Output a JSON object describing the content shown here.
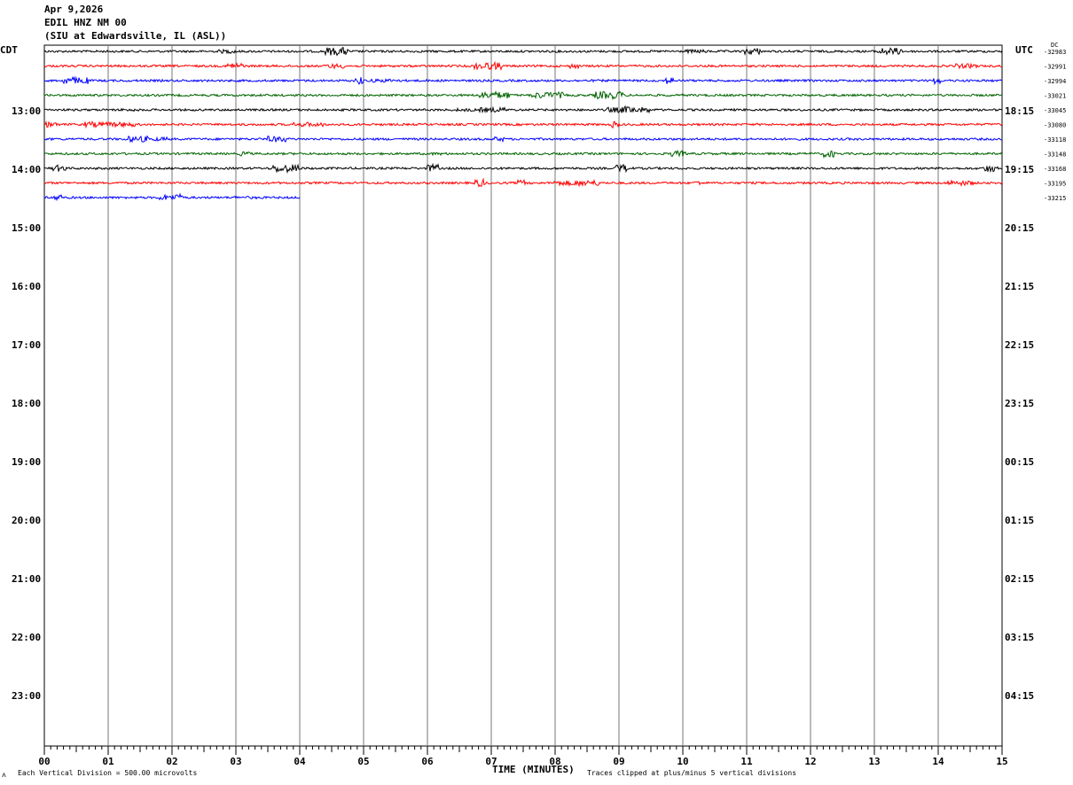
{
  "header": {
    "date": "Apr 9,2026",
    "channel": "EDIL HNZ NM 00",
    "station": "(SIU at Edwardsville, IL  (ASL))"
  },
  "footer": {
    "scale_note": "Each Vertical Division =  500.00 microvolts",
    "clip_note": "Traces clipped at plus/minus 5 vertical divisions",
    "corner_mark": "ᴧ"
  },
  "chart_data": {
    "type": "line",
    "title": "EDIL HNZ NM 00",
    "xlabel": "TIME (MINUTES)",
    "xlim": [
      0,
      15
    ],
    "x_ticks": [
      "00",
      "01",
      "02",
      "03",
      "04",
      "05",
      "06",
      "07",
      "08",
      "09",
      "10",
      "11",
      "12",
      "13",
      "14",
      "15"
    ],
    "left_axis_label": "CDT",
    "right_axis_label": "UTC",
    "dc_label": "DC",
    "left_time_labels": [
      "13:00",
      "14:00",
      "15:00",
      "16:00",
      "17:00",
      "18:00",
      "19:00",
      "20:00",
      "21:00",
      "22:00",
      "23:00"
    ],
    "right_time_labels": [
      "18:15",
      "19:15",
      "20:15",
      "21:15",
      "22:15",
      "23:15",
      "00:15",
      "01:15",
      "02:15",
      "03:15",
      "04:15"
    ],
    "grid": true,
    "traces": [
      {
        "color": "#000000",
        "dc_offset": "-32983",
        "end_minute": 15
      },
      {
        "color": "#ff0000",
        "dc_offset": "-32991",
        "end_minute": 15
      },
      {
        "color": "#0000ff",
        "dc_offset": "-32994",
        "end_minute": 15
      },
      {
        "color": "#006400",
        "dc_offset": "-33021",
        "end_minute": 15
      },
      {
        "color": "#000000",
        "dc_offset": "-33045",
        "end_minute": 15
      },
      {
        "color": "#ff0000",
        "dc_offset": "-33080",
        "end_minute": 15
      },
      {
        "color": "#0000ff",
        "dc_offset": "-33118",
        "end_minute": 15
      },
      {
        "color": "#006400",
        "dc_offset": "-33148",
        "end_minute": 15
      },
      {
        "color": "#000000",
        "dc_offset": "-33168",
        "end_minute": 15
      },
      {
        "color": "#ff0000",
        "dc_offset": "-33195",
        "end_minute": 15
      },
      {
        "color": "#0000ff",
        "dc_offset": "-33215",
        "end_minute": 4
      }
    ]
  }
}
